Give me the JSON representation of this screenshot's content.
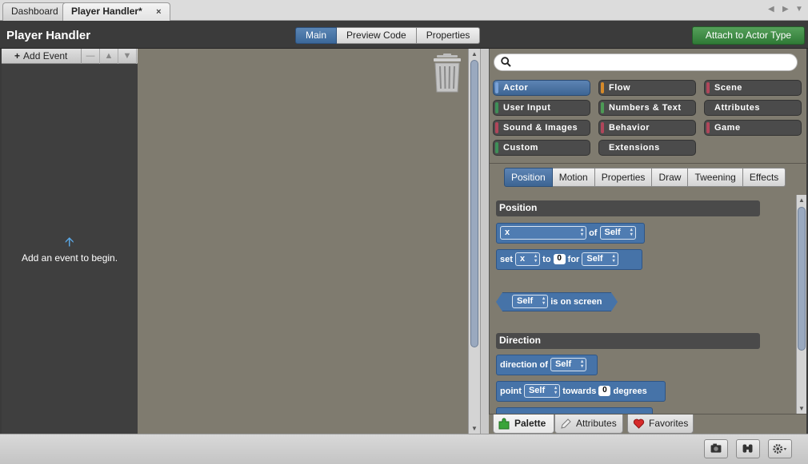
{
  "tabs": [
    {
      "label": "Dashboard",
      "active": false
    },
    {
      "label": "Player Handler*",
      "active": true
    }
  ],
  "tab_close": "×",
  "header": {
    "title": "Player Handler",
    "modes": [
      "Main",
      "Preview Code",
      "Properties"
    ],
    "active_mode": "Main",
    "attach_button": "Attach to Actor Type"
  },
  "events": {
    "add_event_label": "Add Event",
    "empty_message": "Add an event to begin."
  },
  "palette": {
    "search_value": "",
    "categories": [
      {
        "label": "Actor",
        "color": "#5b84c0",
        "selected": true
      },
      {
        "label": "Flow",
        "color": "#d68a2a"
      },
      {
        "label": "Scene",
        "color": "#b0465a"
      },
      {
        "label": "User Input",
        "color": "#3f8f58"
      },
      {
        "label": "Numbers & Text",
        "color": "#4c9a55"
      },
      {
        "label": "Attributes",
        "color": "#4b4b4b"
      },
      {
        "label": "Sound & Images",
        "color": "#b0465a"
      },
      {
        "label": "Behavior",
        "color": "#b0465a"
      },
      {
        "label": "Game",
        "color": "#b0465a"
      },
      {
        "label": "Custom",
        "color": "#3f8f58"
      },
      {
        "label": "Extensions",
        "color": "#4b4b4b"
      }
    ],
    "subtabs": [
      "Position",
      "Motion",
      "Properties",
      "Draw",
      "Tweening",
      "Effects"
    ],
    "active_subtab": "Position",
    "sections": {
      "position": "Position",
      "direction": "Direction"
    },
    "blocks": {
      "b1_dropdown": "x",
      "b1_of": "of",
      "b1_target": "Self",
      "b2_set": "set",
      "b2_dropdown": "x",
      "b2_to": "to",
      "b2_value": "0",
      "b2_for": "for",
      "b2_target": "Self",
      "b3_target": "Self",
      "b3_text": "is on screen",
      "b4_text": "direction of",
      "b4_target": "Self",
      "b5_point": "point",
      "b5_target": "Self",
      "b5_towards": "towards",
      "b5_value": "0",
      "b5_degrees": "degrees"
    },
    "bottom_tabs": [
      "Palette",
      "Attributes",
      "Favorites"
    ],
    "active_bottom_tab": "Palette"
  }
}
